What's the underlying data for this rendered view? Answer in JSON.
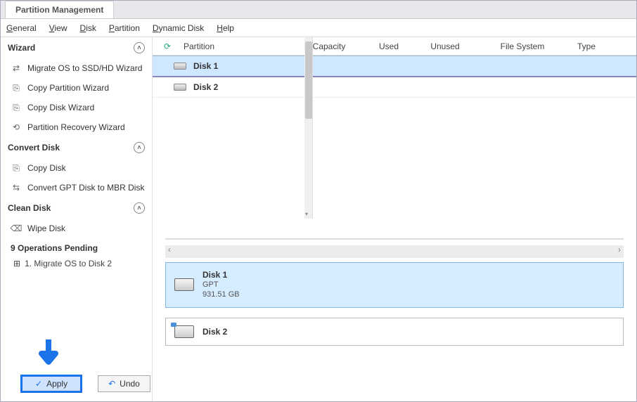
{
  "tab_title": "Partition Management",
  "menu": {
    "general": "General",
    "view": "View",
    "disk": "Disk",
    "partition": "Partition",
    "dynamic_disk": "Dynamic Disk",
    "help": "Help"
  },
  "sidebar": {
    "wizard": {
      "title": "Wizard",
      "items": [
        "Migrate OS to SSD/HD Wizard",
        "Copy Partition Wizard",
        "Copy Disk Wizard",
        "Partition Recovery Wizard"
      ]
    },
    "convert": {
      "title": "Convert Disk",
      "items": [
        "Copy Disk",
        "Convert GPT Disk to MBR Disk"
      ]
    },
    "clean": {
      "title": "Clean Disk",
      "items": [
        "Wipe Disk"
      ]
    },
    "pending": {
      "title": "9 Operations Pending",
      "items": [
        "1. Migrate OS to Disk 2"
      ]
    },
    "apply_label": "Apply",
    "undo_label": "Undo"
  },
  "grid": {
    "headers": {
      "partition": "Partition",
      "capacity": "Capacity",
      "used": "Used",
      "unused": "Unused",
      "file_system": "File System",
      "type": "Type"
    },
    "rows": [
      {
        "name": "Disk 1",
        "selected": true
      },
      {
        "name": "Disk 2",
        "selected": false
      }
    ]
  },
  "panels": [
    {
      "name": "Disk 1",
      "scheme": "GPT",
      "size": "931.51 GB",
      "selected": true,
      "usb": false
    },
    {
      "name": "Disk 2",
      "scheme": "",
      "size": "",
      "selected": false,
      "usb": true
    }
  ]
}
